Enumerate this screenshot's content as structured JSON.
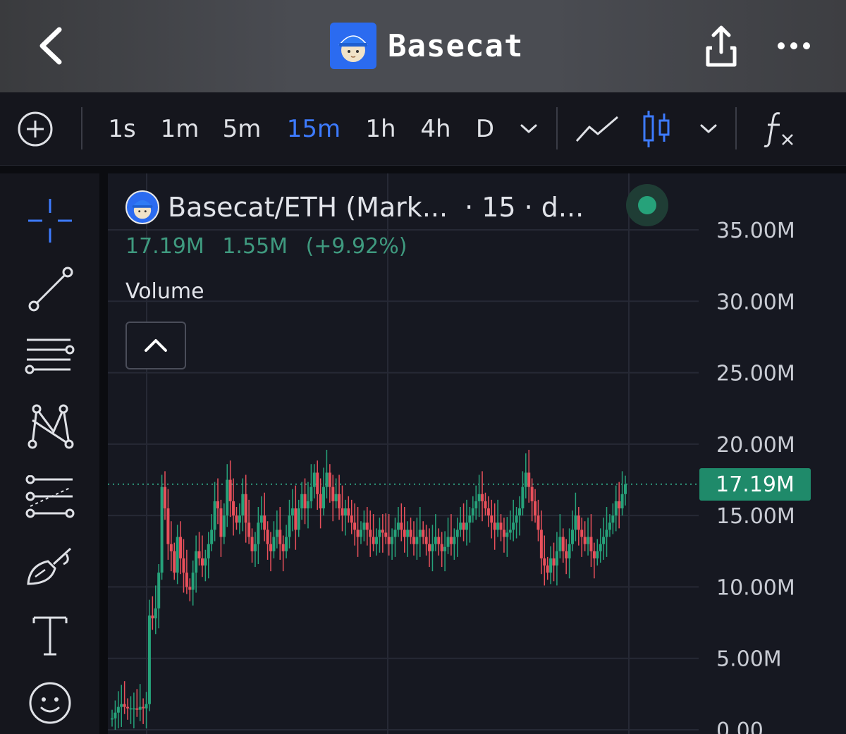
{
  "header": {
    "title": "Basecat",
    "back_icon": "chevron-left-icon",
    "share_icon": "share-icon",
    "more_icon": "more-horizontal-icon"
  },
  "toolbar": {
    "timeframes": [
      "1s",
      "1m",
      "5m",
      "15m",
      "1h",
      "4h",
      "D"
    ],
    "active_timeframe": "15m",
    "accent_color": "#3d7bff"
  },
  "chart_header": {
    "pair": "Basecat/ETH (Mark...",
    "interval_text": "· 15 · d...",
    "last_value": "17.19M",
    "change_value": "1.55M",
    "change_percent": "(+9.92%)",
    "indicator_label": "Volume",
    "status_color": "#26a27a"
  },
  "chart_data": {
    "type": "candlestick",
    "title": "Basecat/ETH (Mark...",
    "y_axis_labels": [
      "35.00M",
      "30.00M",
      "25.00M",
      "20.00M",
      "15.00M",
      "10.00M",
      "5.00M",
      "0.00"
    ],
    "ylim": [
      0,
      35
    ],
    "unit": "M",
    "current_price_label": "17.19M",
    "current_price": 17.19,
    "up_color": "#26a27a",
    "down_color": "#e8505b",
    "series": [
      {
        "values_close": [
          0.8,
          1.2,
          1.6,
          1.8,
          1.6,
          1.5,
          1.5,
          1.5,
          1.4,
          1.6,
          1.5,
          1.8,
          8.0,
          7.8,
          8.5,
          11.0,
          17.0,
          15.5,
          13.0,
          12.5,
          11.0,
          13.5,
          12.0,
          11.0,
          10.0,
          9.8,
          11.0,
          12.5,
          12.0,
          11.5,
          12.0,
          13.0,
          14.0,
          16.0,
          15.5,
          13.5,
          15.0,
          17.5,
          16.0,
          15.0,
          14.5,
          15.0,
          16.5,
          14.5,
          13.5,
          12.5,
          13.0,
          14.5,
          15.0,
          14.0,
          13.0,
          12.5,
          13.5,
          14.0,
          13.0,
          12.5,
          13.5,
          15.0,
          15.5,
          14.0,
          15.5,
          16.5,
          15.5,
          16.0,
          17.0,
          18.0,
          16.5,
          15.5,
          17.0,
          18.0,
          17.0,
          16.0,
          16.5,
          15.5,
          15.0,
          15.5,
          15.0,
          14.5,
          14.0,
          13.5,
          14.0,
          14.5,
          14.0,
          13.5,
          13.0,
          13.5,
          14.0,
          13.8,
          13.5,
          13.0,
          13.5,
          14.0,
          14.5,
          14.0,
          13.5,
          14.0,
          13.5,
          13.0,
          13.5,
          14.0,
          13.5,
          13.0,
          12.5,
          13.0,
          13.5,
          13.0,
          12.5,
          12.8,
          13.5,
          13.0,
          13.5,
          14.0,
          14.5,
          14.0,
          14.5,
          15.0,
          15.5,
          16.0,
          16.5,
          16.0,
          15.5,
          15.0,
          14.5,
          14.0,
          14.5,
          14.0,
          13.5,
          13.8,
          14.0,
          14.5,
          15.0,
          15.5,
          17.0,
          18.0,
          17.0,
          16.0,
          15.0,
          14.0,
          12.0,
          11.5,
          11.0,
          12.0,
          11.5,
          12.5,
          13.5,
          12.5,
          12.0,
          13.0,
          14.0,
          15.0,
          14.0,
          13.5,
          13.0,
          13.5,
          12.5,
          12.0,
          12.5,
          13.0,
          13.5,
          14.0,
          14.5,
          15.0,
          16.0,
          15.5,
          16.5,
          17.19
        ]
      }
    ]
  }
}
